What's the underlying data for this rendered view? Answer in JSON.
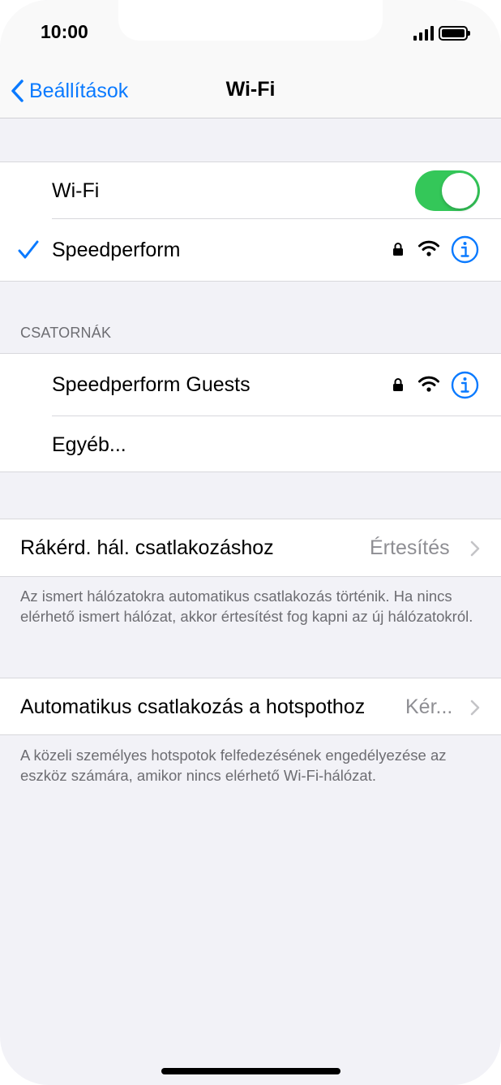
{
  "status_bar": {
    "time": "10:00"
  },
  "nav": {
    "back_label": "Beállítások",
    "title": "Wi-Fi"
  },
  "wifi_group": {
    "wifi_label": "Wi-Fi",
    "wifi_enabled": true,
    "connected_network": "Speedperform"
  },
  "networks_section": {
    "header": "CSATORNÁK",
    "items": [
      {
        "name": "Speedperform Guests",
        "secured": true
      },
      {
        "name": "Egyéb..."
      }
    ]
  },
  "ask_join": {
    "label": "Rákérd. hál. csatlakozáshoz",
    "value": "Értesítés",
    "footer": "Az ismert hálózatokra automatikus csatlakozás történik. Ha nincs elérhető ismert hálózat, akkor értesítést fog kapni az új hálózatokról."
  },
  "auto_hotspot": {
    "label": "Automatikus csatlakozás a hotspothoz",
    "value": "Kér...",
    "footer": "A közeli személyes hotspotok felfedezésének engedélyezése az eszköz számára, amikor nincs elérhető Wi-Fi-hálózat."
  },
  "colors": {
    "accent": "#0a7aff",
    "toggle_on": "#34c759",
    "secondary_text": "#8e8e93",
    "background": "#f2f2f7"
  }
}
